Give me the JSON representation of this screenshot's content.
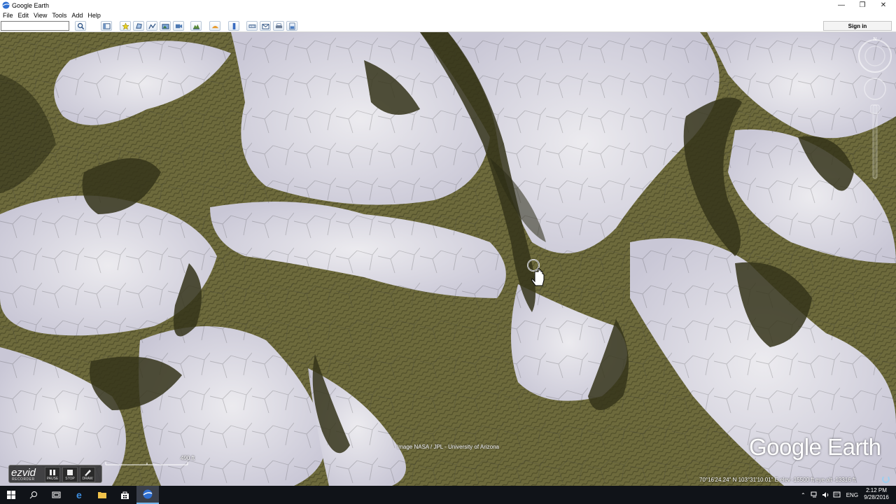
{
  "window": {
    "title": "Google Earth",
    "controls": {
      "minimize": "—",
      "restore": "❐",
      "close": "✕"
    }
  },
  "menu": [
    "File",
    "Edit",
    "View",
    "Tools",
    "Add",
    "Help"
  ],
  "search": {
    "value": "",
    "placeholder": ""
  },
  "toolbar": {
    "icons": [
      "search-icon",
      "sidebar-icon",
      "placemark-icon",
      "polygon-icon",
      "path-icon",
      "overlay-icon",
      "record-tour-icon",
      "historical-imagery-icon",
      "sun-icon",
      "planets-icon",
      "ruler-icon",
      "email-icon",
      "print-icon",
      "save-image-icon",
      "maps-icon"
    ],
    "sign_in": "Sign in"
  },
  "map": {
    "image_credit": "Image NASA / JPL - University of Arizona",
    "logo": "Google Earth",
    "scale_label": "490 ft",
    "coordinates": "70°16'24.24\" N  103°31'10.01\" E  elev -15500 ft",
    "eye_alt": "eye alt -13316 ft",
    "compass_north": "N"
  },
  "recorder": {
    "logo": "ezvid",
    "sub": "RECORDER",
    "buttons": [
      "PAUSE",
      "STOP",
      "DRAW"
    ]
  },
  "taskbar": {
    "language": "ENG",
    "time": "2:12 PM",
    "date": "9/28/2016"
  },
  "colors": {
    "dune_dark": "#4a4a22",
    "dune_olive": "#6f6b3a",
    "frost": "#e4e4ea",
    "taskbar": "#101318",
    "accent": "#76b9ed"
  }
}
